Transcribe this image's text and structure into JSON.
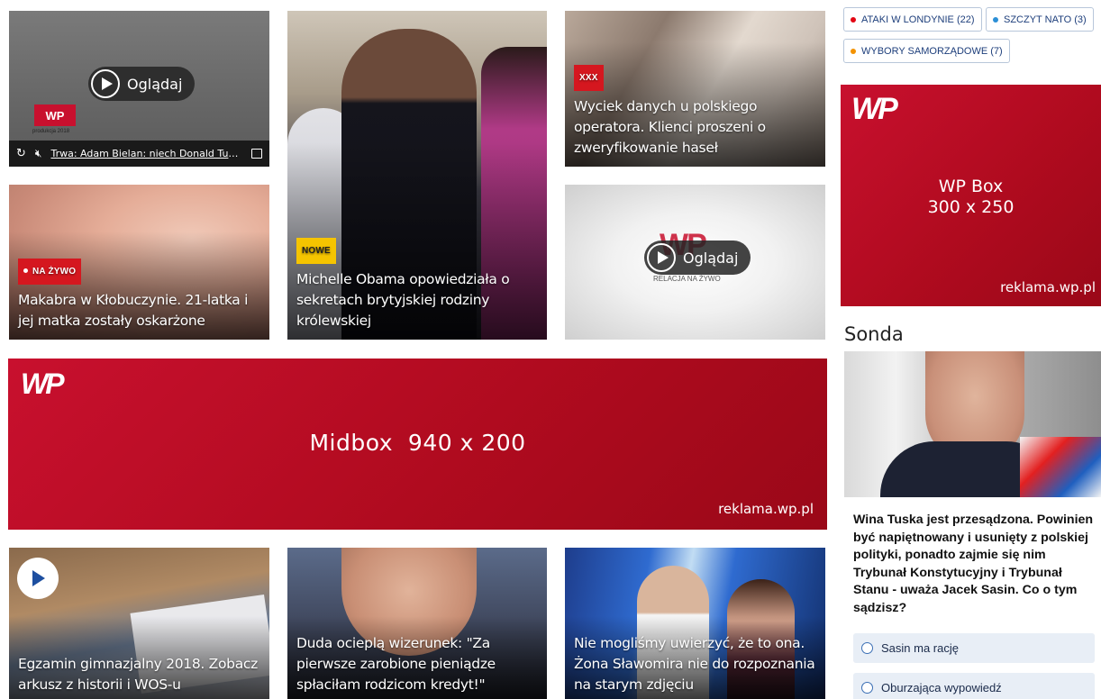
{
  "tags": [
    {
      "label": "ATAKI W LONDYNIE (22)",
      "dot_color": "#e30613"
    },
    {
      "label": "SZCZYT NATO (3)",
      "dot_color": "#2b8fd6"
    },
    {
      "label": "WYBORY SAMORZĄDOWE (7)",
      "dot_color": "#f39200"
    }
  ],
  "tiles": {
    "video1": {
      "play_label": "Oglądaj",
      "logo_text": "WP",
      "logo_sub": "produkcja 2018",
      "bar_title": "Trwa: Adam Bielan: niech Donald Tusk..."
    },
    "klobuck": {
      "badge": "NA ŻYWO",
      "caption": "Makabra w Kłobuczynie. 21-latka i jej matka zostały oskarżone"
    },
    "obama": {
      "badge": "NOWE",
      "caption": "Michelle Obama opowiedziała o sekretach brytyjskiej rodziny królewskiej"
    },
    "wyciek": {
      "badge": "XXX",
      "caption": "Wyciek danych u polskiego operatora. Klienci proszeni o zweryfikowanie haseł"
    },
    "video2": {
      "play_label": "Oglądaj",
      "logo_text": "WP",
      "logo_sub": "RELACJA NA ŻYWO"
    },
    "egzamin": {
      "caption": "Egzamin gimnazjalny 2018. Zobacz arkusz z historii i WOS-u"
    },
    "duda": {
      "caption": "Duda ocieplą wizerunek: \"Za pierwsze zarobione pieniądze spłaciłam rodzicom kredyt!\""
    },
    "zona": {
      "caption": "Nie mogliśmy uwierzyć, że to ona. Żona Sławomira nie do rozpoznania na starym zdjęciu"
    }
  },
  "ads": {
    "box": {
      "logo": "WP",
      "size_line1": "WP Box",
      "size_line2": "300 x 250",
      "url": "reklama.wp.pl"
    },
    "midbox": {
      "logo": "WP",
      "size": "Midbox  940 x 200",
      "url": "reklama.wp.pl"
    }
  },
  "sonda": {
    "title": "Sonda",
    "question": "Wina Tuska jest przesądzona. Powinien być napiętnowany i usunięty z polskiej polityki, ponadto zajmie się nim Trybunał Konstytucyjny i Trybunał Stanu - uważa Jacek Sasin. Co o tym sądzisz?",
    "options": [
      "Sasin ma rację",
      "Oburzająca wypowiedź"
    ]
  },
  "colors": {
    "brand_red": "#c8102e",
    "badge_red": "#d5171f",
    "badge_yellow": "#f5c400",
    "link_blue": "#1d3e7b"
  }
}
